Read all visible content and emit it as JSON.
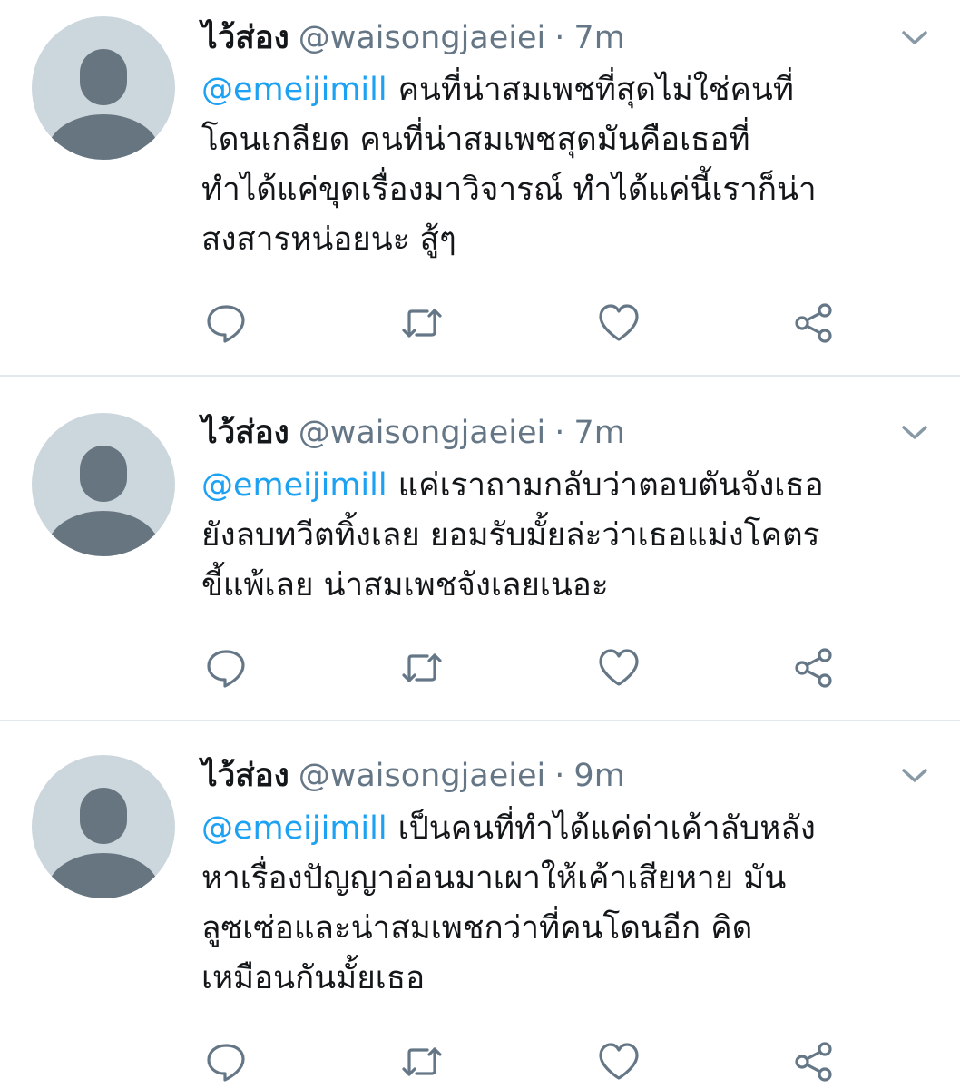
{
  "icons": {
    "reply": "reply-icon",
    "retweet": "retweet-icon",
    "like": "like-icon",
    "share": "share-icon",
    "caret": "chevron-down-icon",
    "avatar": "default-avatar-icon"
  },
  "colors": {
    "mention": "#1da1f2",
    "secondary_text": "#657786",
    "avatar_bg": "#ccd6dd",
    "avatar_fg": "#66757f",
    "divider": "#e1e8ed"
  },
  "tweets": [
    {
      "display_name": "ไว้ส่อง",
      "handle": "@waisongjaeiei",
      "separator": "·",
      "time": "7m",
      "mention": "@emeijimill",
      "lines": [
        "คนที่น่าสมเพชที่สุดไม่ใช่คนที่",
        "โดนเกลียด คนที่น่าสมเพชสุดมันคือเธอที่",
        "ทำได้แค่ขุดเรื่องมาวิจารณ์ ทำได้แค่นี้เราก็น่า",
        "สงสารหน่อยนะ สู้ๆ"
      ]
    },
    {
      "display_name": "ไว้ส่อง",
      "handle": "@waisongjaeiei",
      "separator": "·",
      "time": "7m",
      "mention": "@emeijimill",
      "lines": [
        "แค่เราถามกลับว่าตอบตันจังเธอ",
        "ยังลบทวีตทิ้งเลย ยอมรับมั้ยล่ะว่าเธอแม่งโคตร",
        "ขี้แพ้เลย น่าสมเพชจังเลยเนอะ"
      ]
    },
    {
      "display_name": "ไว้ส่อง",
      "handle": "@waisongjaeiei",
      "separator": "·",
      "time": "9m",
      "mention": "@emeijimill",
      "lines": [
        "เป็นคนที่ทำได้แค่ด่าเค้าลับหลัง",
        "หาเรื่องปัญญาอ่อนมาเผาให้เค้าเสียหาย มัน",
        "ลูซเซ่อและน่าสมเพชกว่าที่คนโดนอีก คิด",
        "เหมือนกันมั้ยเธอ"
      ]
    }
  ]
}
